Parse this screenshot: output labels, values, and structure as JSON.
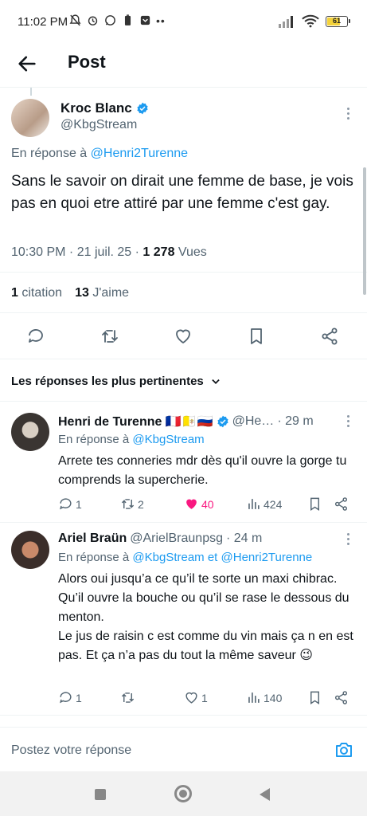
{
  "status_bar": {
    "time": "11:02 PM",
    "battery": "61"
  },
  "header": {
    "title": "Post"
  },
  "post": {
    "author_name": "Kroc Blanc",
    "author_handle": "@KbgStream",
    "reply_prefix": "En réponse à",
    "reply_to": "@Henri2Turenne",
    "text": "Sans le savoir on dirait une femme de base, je vois pas en quoi etre attiré par une femme c'est gay.",
    "time": "10:30 PM",
    "date": "21 juil. 25",
    "views_count": "1 278",
    "views_label": "Vues",
    "quotes_count": "1",
    "quotes_label": "citation",
    "likes_count": "13",
    "likes_label": "J'aime"
  },
  "sort": {
    "label": "Les réponses les plus pertinentes"
  },
  "replies": [
    {
      "name": "Henri de Turenne 🇫🇷🇻🇦🇷🇺",
      "handle": "@He…",
      "time": "· 29 m",
      "reply_prefix": "En réponse à",
      "reply_to": "@KbgStream",
      "text": "Arrete tes conneries mdr dès qu'il ouvre la gorge tu comprends la supercherie.",
      "replies": "1",
      "reposts": "2",
      "likes": "40",
      "views": "424"
    },
    {
      "name": "Ariel Braün",
      "handle": "@ArielBraunpsg",
      "time": "· 24 m",
      "reply_prefix": "En réponse à",
      "reply_to": "@KbgStream et @Henri2Turenne",
      "text": "Alors oui jusqu’a ce qu’il te sorte un maxi chibrac. Qu’il ouvre la bouche ou qu’il se rase le dessous du menton.\nLe jus de raisin c est comme du vin mais ça n en est pas. Et ça n’a pas du tout la même saveur 😉",
      "replies": "1",
      "reposts": "",
      "likes": "1",
      "views": "140"
    }
  ],
  "compose": {
    "placeholder": "Postez votre réponse"
  },
  "colors": {
    "accent": "#1d9bf0",
    "like": "#f91880",
    "muted": "#536471"
  }
}
